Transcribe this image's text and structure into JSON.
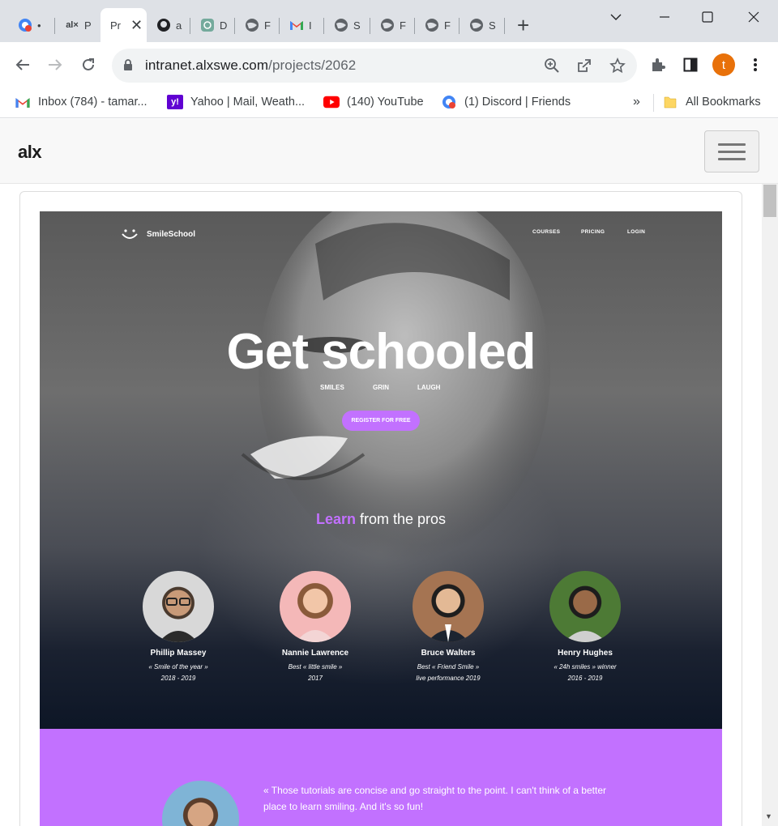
{
  "browser": {
    "tabs": [
      {
        "icon": "discord-icon",
        "title": "•"
      },
      {
        "icon": "alx-icon",
        "title": "P"
      },
      {
        "icon": "alx-icon",
        "title": "Pr",
        "active": true
      },
      {
        "icon": "github-icon",
        "title": "a"
      },
      {
        "icon": "chatgpt-icon",
        "title": "D"
      },
      {
        "icon": "globe-icon",
        "title": "F"
      },
      {
        "icon": "gmail-icon",
        "title": "I"
      },
      {
        "icon": "globe-icon",
        "title": "S"
      },
      {
        "icon": "globe-icon",
        "title": "F"
      },
      {
        "icon": "globe-icon",
        "title": "F"
      },
      {
        "icon": "globe-icon",
        "title": "S"
      }
    ],
    "address": {
      "host": "intranet.alxswe.com",
      "path": "/projects/2062"
    },
    "profile_initial": "t",
    "profile_color": "#e8710a",
    "bookmarks": [
      {
        "icon": "gmail-icon",
        "label": "Inbox (784) - tamar..."
      },
      {
        "icon": "yahoo-icon",
        "label": "Yahoo | Mail, Weath..."
      },
      {
        "icon": "youtube-icon",
        "label": "(140) YouTube"
      },
      {
        "icon": "discord-icon",
        "label": "(1) Discord | Friends"
      }
    ],
    "bookmarks_overflow": "»",
    "all_bookmarks": "All Bookmarks"
  },
  "site": {
    "logo": "alx"
  },
  "mockup": {
    "brand": "SmileSchool",
    "nav": [
      "COURSES",
      "PRICING",
      "LOGIN"
    ],
    "title": "Get schooled",
    "tags": [
      "SMILES",
      "GRIN",
      "LAUGH"
    ],
    "cta": "REGISTER FOR FREE",
    "learn_strong": "Learn",
    "learn_rest": " from the pros",
    "accent": "#c271ff",
    "people": [
      {
        "name": "Phillip Massey",
        "line1": "« Smile of the year »",
        "line2": "2018 - 2019"
      },
      {
        "name": "Nannie Lawrence",
        "line1": "Best « little smile »",
        "line2": "2017"
      },
      {
        "name": "Bruce Walters",
        "line1": "Best « Friend Smile »",
        "line2": "live performance 2019"
      },
      {
        "name": "Henry Hughes",
        "line1": "« 24h smiles » winner",
        "line2": "2016 - 2019"
      }
    ],
    "quote": "« Those tutorials are concise and go straight to the point. I can't think of a better place to learn smiling. And it's so fun!"
  }
}
